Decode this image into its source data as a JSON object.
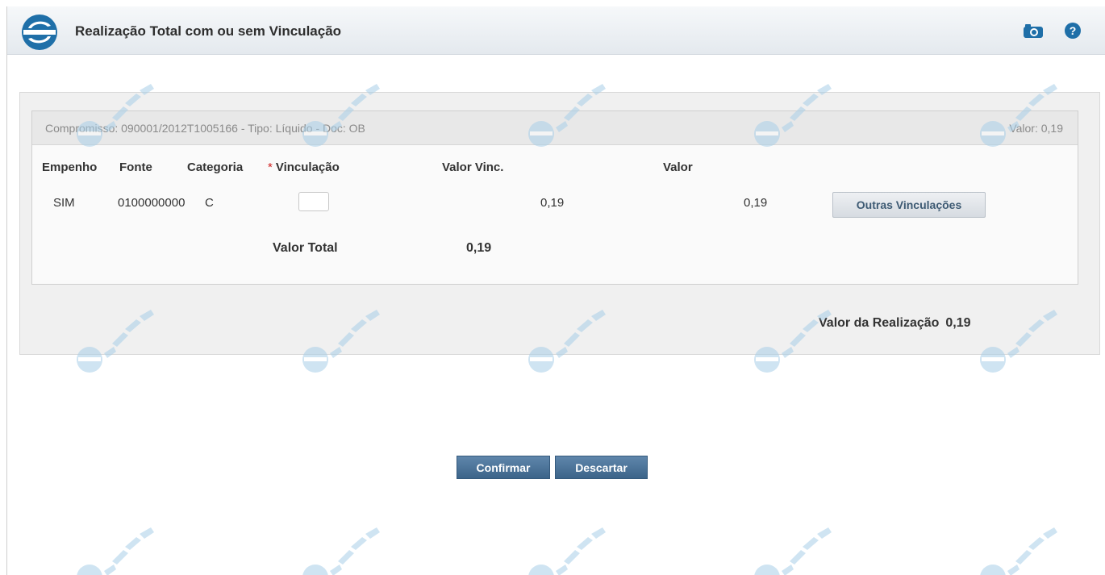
{
  "header": {
    "title": "Realização Total com ou sem Vinculação",
    "logo_icon": "siafi-logo-icon",
    "camera_icon": "camera-icon",
    "help_icon": "help-icon"
  },
  "compromisso": {
    "info": "Compromisso: 090001/2012T1005166 - Tipo: Líquido - Doc: OB",
    "valor": "Valor: 0,19"
  },
  "table": {
    "columns": [
      "Empenho",
      "Fonte",
      "Categoria",
      "Vinculação",
      "Valor Vinc.",
      "Valor"
    ],
    "required_mark": "*",
    "row": {
      "empenho": "SIM",
      "fonte": "0100000000",
      "categoria": "C",
      "vinculacao": "",
      "valor_vinc": "0,19",
      "valor": "0,19"
    },
    "outras_button": "Outras Vinculações",
    "total_label": "Valor Total",
    "total_value": "0,19"
  },
  "realizacao": {
    "label": "Valor da Realização",
    "value": "0,19"
  },
  "actions": {
    "confirm": "Confirmar",
    "discard": "Descartar"
  },
  "colors": {
    "brand": "#1f6fa8",
    "button": "#4a6f94",
    "required": "#d02020",
    "watermark": "#a9cfe8"
  }
}
